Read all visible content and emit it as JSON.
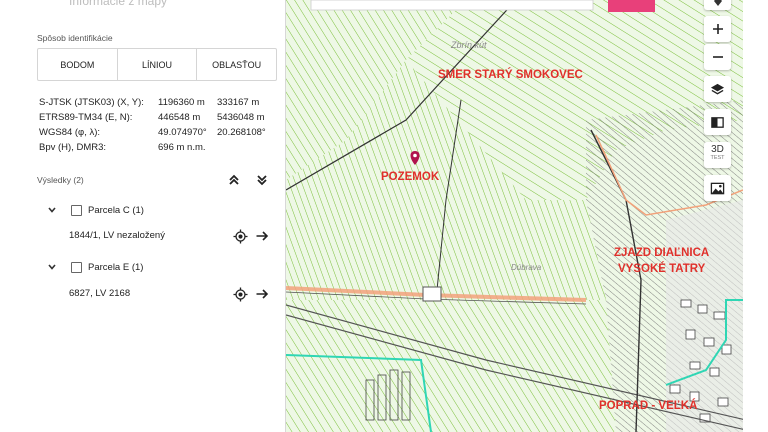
{
  "panel": {
    "title": "Informácie z mapy",
    "method_label": "Spôsob identifikácie",
    "modes": [
      "BODOM",
      "LÍNIOU",
      "OBLASŤOU"
    ],
    "coordinates": [
      {
        "label": "S-JTSK (JTSK03) (X, Y):",
        "v1": "1196360 m",
        "v2": "333167 m"
      },
      {
        "label": "ETRS89-TM34 (E, N):",
        "v1": "446548 m",
        "v2": "5436048 m"
      },
      {
        "label": "WGS84 (φ, λ):",
        "v1": "49.074970°",
        "v2": "20.268108°"
      },
      {
        "label": "Bpv (H), DMR3:",
        "v1": "696 m n.m.",
        "v2": ""
      }
    ],
    "results_label": "Výsledky (2)",
    "results": [
      {
        "title": "Parcela C (1)",
        "detail": "1844/1, LV nezaložený"
      },
      {
        "title": "Parcela E (1)",
        "detail": "6827, LV 2168"
      }
    ]
  },
  "map": {
    "labels": {
      "smer": "SMER STARÝ SMOKOVEC",
      "pozemok": "POZEMOK",
      "zjazd_1": "ZJAZD DIAĽNICA",
      "zjazd_2": "VYSOKÉ TATRY",
      "poprad": "POPRAD - VEĽKÁ",
      "toponym_1": "Zbrín kút",
      "toponym_2": "Dúbrava"
    },
    "controls": {
      "threed": "3D",
      "test": "TEST"
    },
    "colors": {
      "parcel_lines": "#7bbf3a",
      "label_red": "#e0302b",
      "marker": "#b0124d",
      "boundary": "#f2a27b",
      "water": "#2fd6b4"
    }
  }
}
